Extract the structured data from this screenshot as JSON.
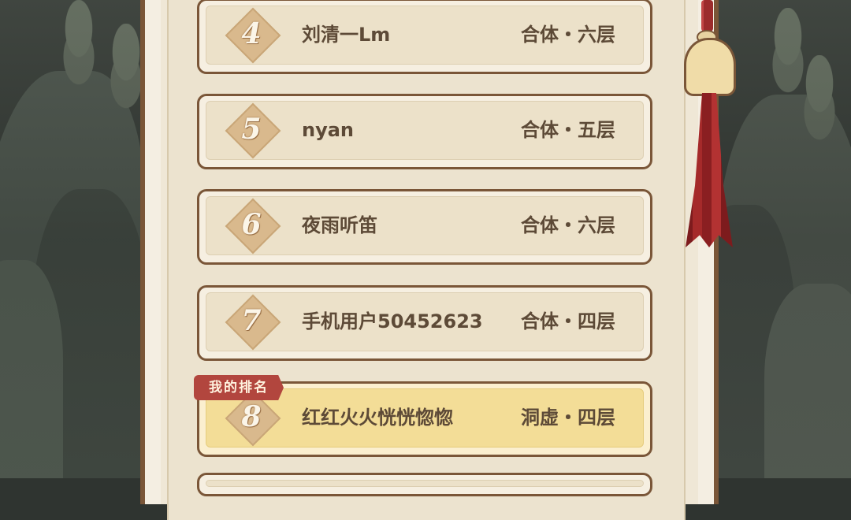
{
  "my_rank_label": "我的排名",
  "rows": [
    {
      "rank": "4",
      "name": "刘清一Lm",
      "realm": "合体・六层"
    },
    {
      "rank": "5",
      "name": "nyan",
      "realm": "合体・五层"
    },
    {
      "rank": "6",
      "name": "夜雨听笛",
      "realm": "合体・六层"
    },
    {
      "rank": "7",
      "name": "手机用户50452623",
      "realm": "合体・四层"
    },
    {
      "rank": "8",
      "name": "红红火火恍恍惚惚",
      "realm": "洞虚・四层",
      "is_me": true
    }
  ],
  "colors": {
    "panel": "#ece3cf",
    "border": "#7a5638",
    "highlight_row": "#f3dd97",
    "badge": "#b2463e",
    "text": "#5d4a37"
  },
  "icons": [
    "rank-diamond-icon",
    "bell-tassel-icon"
  ]
}
